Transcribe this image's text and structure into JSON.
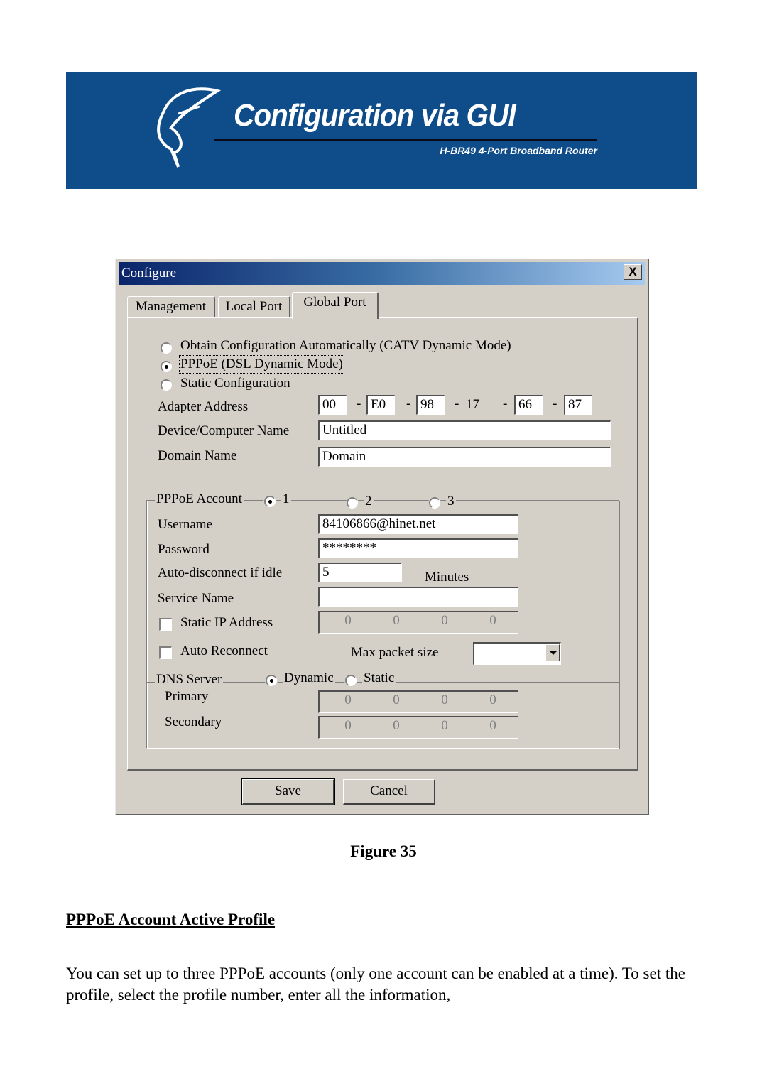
{
  "banner": {
    "title": "Configuration via GUI",
    "subtitle": "H-BR49 4-Port Broadband Router",
    "background_color": "#0f4c8a"
  },
  "dialog": {
    "title": "Configure",
    "close_label": "X",
    "tabs": [
      {
        "label": "Management",
        "active": false
      },
      {
        "label": "Local Port",
        "active": false
      },
      {
        "label": "Global Port",
        "active": true
      }
    ],
    "mode_options": [
      {
        "label": "Obtain Configuration Automatically (CATV Dynamic Mode)",
        "checked": false
      },
      {
        "label": "PPPoE (DSL Dynamic Mode)",
        "checked": true
      },
      {
        "label": "Static Configuration",
        "checked": false
      }
    ],
    "adapter_address": {
      "label": "Adapter Address",
      "octets": [
        "00",
        "E0",
        "98",
        "17",
        "66",
        "87"
      ],
      "separator": "-"
    },
    "device_name": {
      "label": "Device/Computer Name",
      "value": "Untitled"
    },
    "domain_name": {
      "label": "Domain Name",
      "value": "Domain"
    },
    "pppoe_account": {
      "legend": "PPPoE Account",
      "profiles": [
        {
          "label": "1",
          "checked": true
        },
        {
          "label": "2",
          "checked": false
        },
        {
          "label": "3",
          "checked": false
        }
      ],
      "username": {
        "label": "Username",
        "value": "84106866@hinet.net"
      },
      "password": {
        "label": "Password",
        "value": "********"
      },
      "idle": {
        "label": "Auto-disconnect if idle",
        "value": "5",
        "unit": "Minutes"
      },
      "service_name": {
        "label": "Service Name",
        "value": ""
      },
      "static_ip": {
        "label": "Static IP Address",
        "checked": false,
        "octets": [
          "0",
          "0",
          "0",
          "0"
        ]
      },
      "auto_reconnect": {
        "label": "Auto Reconnect",
        "checked": false
      },
      "max_packet": {
        "label": "Max packet size",
        "value": ""
      }
    },
    "dns": {
      "legend": "DNS Server",
      "options": [
        {
          "label": "Dynamic",
          "checked": true
        },
        {
          "label": "Static",
          "checked": false
        }
      ],
      "primary": {
        "label": "Primary",
        "octets": [
          "0",
          "0",
          "0",
          "0"
        ]
      },
      "secondary": {
        "label": "Secondary",
        "octets": [
          "0",
          "0",
          "0",
          "0"
        ]
      }
    },
    "buttons": {
      "save": "Save",
      "cancel": "Cancel"
    }
  },
  "document": {
    "figure_caption": "Figure 35",
    "heading": "PPPoE Account  Active Profile",
    "paragraph": "You can set up to three PPPoE accounts (only one account can be enabled at a time). To set the profile, select the profile number, enter all the information,"
  }
}
